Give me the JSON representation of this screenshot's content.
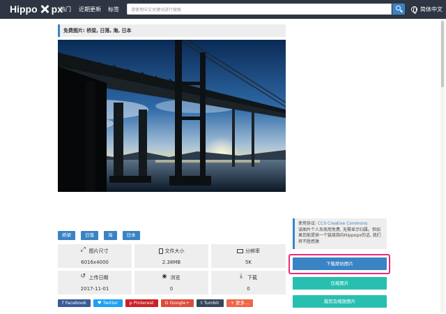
{
  "header": {
    "logo_left": "Hippo",
    "logo_right": "px",
    "nav": [
      "热门",
      "近期更新",
      "标签"
    ],
    "search_placeholder": "请使用中文关键词进行搜索",
    "language": "简体中文"
  },
  "photo": {
    "title": "免费图片: 桥梁, 日落, 海, 日本",
    "tags": [
      "桥梁",
      "日落",
      "海",
      "日本"
    ]
  },
  "info": [
    {
      "label": "图片尺寸",
      "value": "6016x4000",
      "icon": "expand-icon"
    },
    {
      "label": "文件大小",
      "value": "2.38MB",
      "icon": "file-icon"
    },
    {
      "label": "分辨率",
      "value": "5K",
      "icon": "monitor-icon"
    },
    {
      "label": "上传日期",
      "value": "2017-11-01",
      "icon": "history-icon"
    },
    {
      "label": "浏览",
      "value": "0",
      "icon": "eye-icon"
    },
    {
      "label": "下载",
      "value": "0",
      "icon": "download-icon"
    }
  ],
  "social": [
    {
      "label": "f  Facebook",
      "color": "#3b5998"
    },
    {
      "label": "♥ Twitter",
      "color": "#1da1f2"
    },
    {
      "label": "p  Pinterest",
      "color": "#cb2027"
    },
    {
      "label": "G  Google+",
      "color": "#dd4b39"
    },
    {
      "label": "t  Tumblr",
      "color": "#35465c"
    },
    {
      "label": "+  更多...",
      "color": "#f06649"
    }
  ],
  "license": {
    "prefix": "使用协议: ",
    "link": "CC0 Creative Commons",
    "text": "该图片个人及商用免费, 无需显示归属。但如果您能提供一个链接指向Hippopx的话, 我们将不胜感激"
  },
  "actions": {
    "download_original": "下载原始图片",
    "compress": "压缩图片",
    "crop_resize": "裁剪及缩放图片"
  },
  "colors": {
    "header_bg": "#2f3542",
    "accent": "#3a83c4",
    "teal": "#28bfb0",
    "highlight": "#e9297e"
  }
}
